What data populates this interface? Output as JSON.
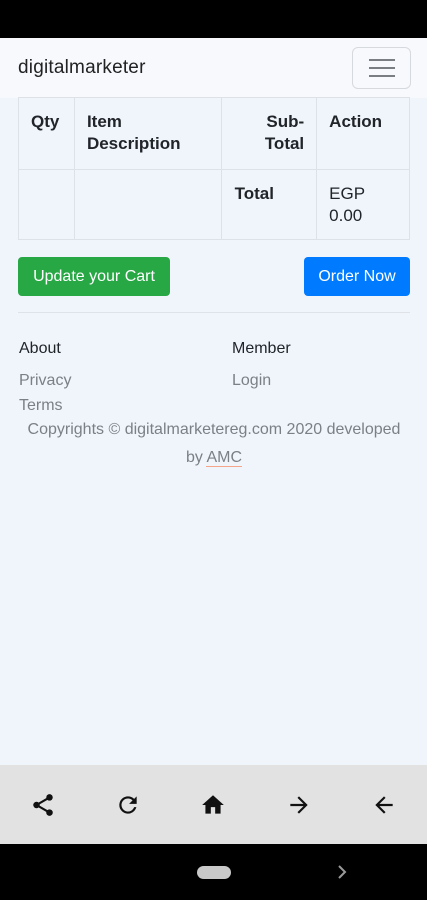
{
  "header": {
    "brand": "digitalmarketer"
  },
  "cart_table": {
    "headers": {
      "qty": "Qty",
      "item_line1": "Item",
      "item_line2": "Description",
      "sub_line1": "Sub-",
      "sub_line2": "Total",
      "action": "Action"
    },
    "total_row": {
      "label": "Total",
      "currency": "EGP",
      "amount": "0.00"
    }
  },
  "buttons": {
    "update": "Update your Cart",
    "order": "Order Now"
  },
  "footer": {
    "about_heading": "About",
    "privacy": "Privacy",
    "terms": "Terms",
    "member_heading": "Member",
    "login": "Login",
    "copyright_line1": "Copyrights © digitalmarketereg.com 2020 developed",
    "copyright_by": "by",
    "copyright_link": "AMC"
  },
  "colors": {
    "update_button": "#28a745",
    "order_button": "#007bff",
    "page_background": "#f0f5fc"
  },
  "toolbar_icons": [
    "share-icon",
    "refresh-icon",
    "home-icon",
    "forward-icon",
    "back-icon"
  ]
}
